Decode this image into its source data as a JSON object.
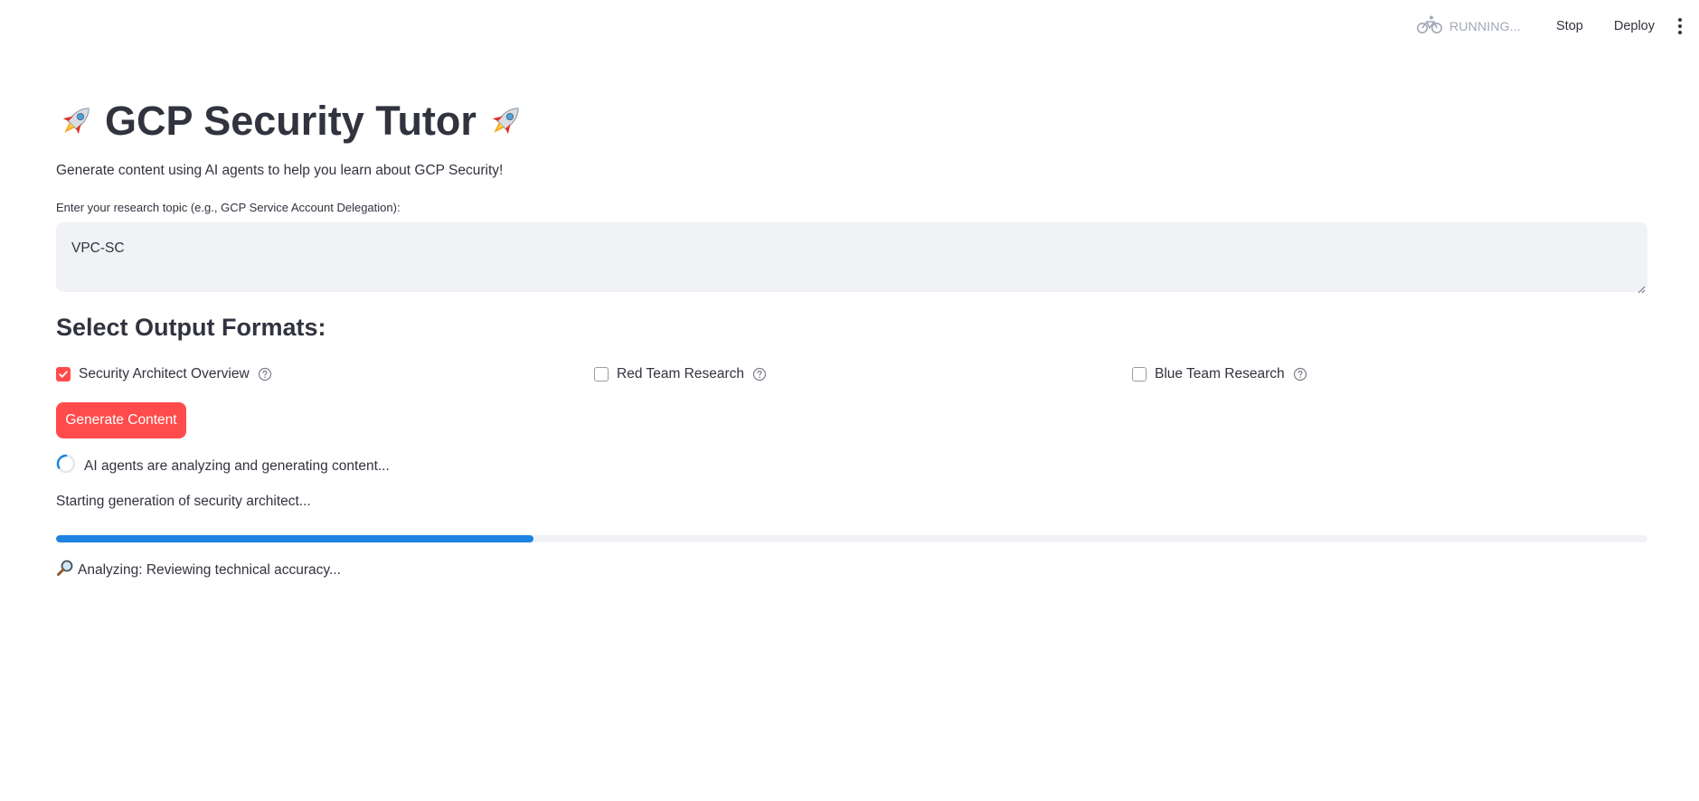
{
  "header": {
    "status_label": "RUNNING...",
    "status_icon": "bicycle-icon",
    "stop_label": "Stop",
    "deploy_label": "Deploy",
    "menu_icon": "kebab-menu-icon"
  },
  "main": {
    "title": "GCP Security Tutor",
    "title_icon": "rocket-icon",
    "subtitle": "Generate content using AI agents to help you learn about GCP Security!",
    "topic_label": "Enter your research topic (e.g., GCP Service Account Delegation):",
    "topic_value": "VPC-SC",
    "formats_heading": "Select Output Formats:",
    "formats": [
      {
        "label": "Security Architect Overview",
        "checked": true
      },
      {
        "label": "Red Team Research",
        "checked": false
      },
      {
        "label": "Blue Team Research",
        "checked": false
      }
    ],
    "generate_label": "Generate Content",
    "spinner_text": "AI agents are analyzing and generating content...",
    "progress_text": "Starting generation of security architect...",
    "progress_value": 0.3,
    "analyzing_text": "Analyzing: Reviewing technical accuracy...",
    "analyzing_icon": "magnifying-glass-icon"
  },
  "colors": {
    "accent": "#ff4b4b",
    "progress": "#1c83e1",
    "input_bg": "#f0f2f6",
    "text": "#31333f",
    "muted": "#a3a8b8"
  }
}
